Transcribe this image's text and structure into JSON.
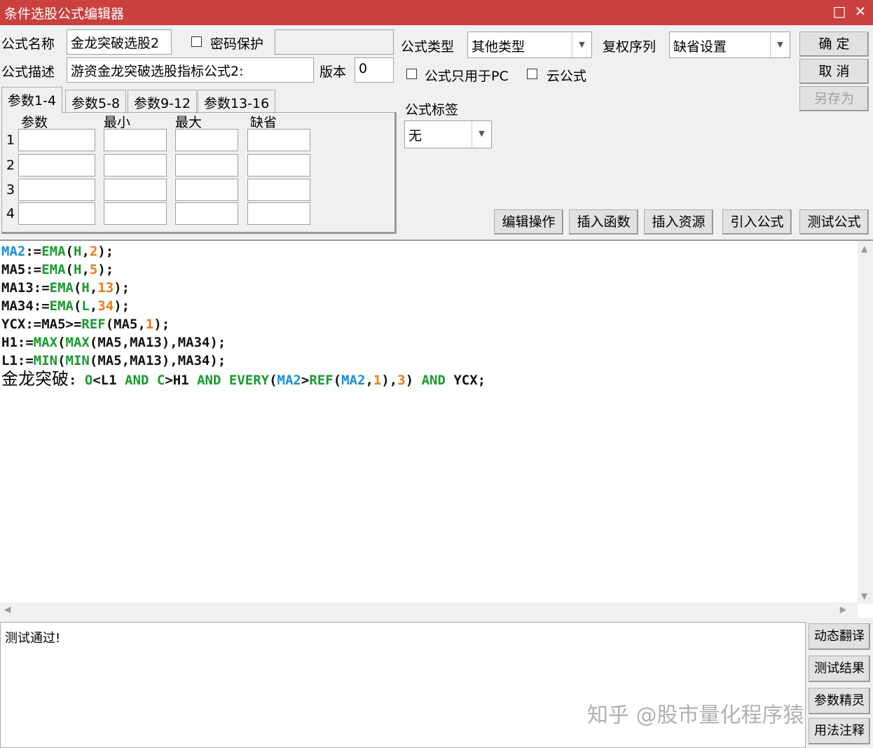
{
  "window": {
    "title": "条件选股公式编辑器",
    "maximize_icon": "□",
    "close_icon": "✕"
  },
  "form": {
    "name_label": "公式名称",
    "name_value": "金龙突破选股2",
    "password_label": "密码保护",
    "password_value": "",
    "desc_label": "公式描述",
    "desc_value": "游资金龙突破选股指标公式2:",
    "version_label": "版本",
    "version_value": "0",
    "type_label": "公式类型",
    "type_value": "其他类型",
    "rights_label": "复权序列",
    "rights_value": "缺省设置",
    "pc_only_label": "公式只用于PC",
    "cloud_label": "云公式",
    "tag_label": "公式标签",
    "tag_value": "无"
  },
  "buttons": {
    "ok": "确  定",
    "cancel": "取  消",
    "save_as": "另存为"
  },
  "params": {
    "tabs": [
      "参数1-4",
      "参数5-8",
      "参数9-12",
      "参数13-16"
    ],
    "headers": [
      "参数",
      "最小",
      "最大",
      "缺省"
    ],
    "rows": [
      "1",
      "2",
      "3",
      "4"
    ]
  },
  "toolbar": [
    "编辑操作",
    "插入函数",
    "插入资源",
    "引入公式",
    "测试公式"
  ],
  "code": [
    [
      [
        "MA2",
        "b"
      ],
      [
        ":=",
        "k"
      ],
      [
        "EMA",
        "g"
      ],
      [
        "(",
        "k"
      ],
      [
        "H",
        "g"
      ],
      [
        ",",
        "k"
      ],
      [
        "2",
        "o"
      ],
      [
        ");",
        "k"
      ]
    ],
    [
      [
        "MA5:=",
        "k"
      ],
      [
        "EMA",
        "g"
      ],
      [
        "(",
        "k"
      ],
      [
        "H",
        "g"
      ],
      [
        ",",
        "k"
      ],
      [
        "5",
        "o"
      ],
      [
        ");",
        "k"
      ]
    ],
    [
      [
        "MA13:=",
        "k"
      ],
      [
        "EMA",
        "g"
      ],
      [
        "(",
        "k"
      ],
      [
        "H",
        "g"
      ],
      [
        ",",
        "k"
      ],
      [
        "13",
        "o"
      ],
      [
        ");",
        "k"
      ]
    ],
    [
      [
        "MA34:=",
        "k"
      ],
      [
        "EMA",
        "g"
      ],
      [
        "(",
        "k"
      ],
      [
        "L",
        "g"
      ],
      [
        ",",
        "k"
      ],
      [
        "34",
        "o"
      ],
      [
        ");",
        "k"
      ]
    ],
    [
      [
        "YCX:=MA5>=",
        "k"
      ],
      [
        "REF",
        "g"
      ],
      [
        "(MA5,",
        "k"
      ],
      [
        "1",
        "o"
      ],
      [
        ");",
        "k"
      ]
    ],
    [
      [
        "H1:=",
        "k"
      ],
      [
        "MAX",
        "g"
      ],
      [
        "(",
        "k"
      ],
      [
        "MAX",
        "g"
      ],
      [
        "(MA5,MA13),MA34);",
        "k"
      ]
    ],
    [
      [
        "L1:=",
        "k"
      ],
      [
        "MIN",
        "g"
      ],
      [
        "(",
        "k"
      ],
      [
        "MIN",
        "g"
      ],
      [
        "(MA5,MA13),MA34);",
        "k"
      ]
    ],
    [
      [
        "金龙突破",
        "zh"
      ],
      [
        ": ",
        "k"
      ],
      [
        "O",
        "g"
      ],
      [
        "<L1 ",
        "k"
      ],
      [
        "AND",
        "g"
      ],
      [
        " ",
        "k"
      ],
      [
        "C",
        "g"
      ],
      [
        ">H1 ",
        "k"
      ],
      [
        "AND",
        "g"
      ],
      [
        " ",
        "k"
      ],
      [
        "EVERY",
        "g"
      ],
      [
        "(",
        "k"
      ],
      [
        "MA2",
        "b"
      ],
      [
        ">",
        "k"
      ],
      [
        "REF",
        "g"
      ],
      [
        "(",
        "k"
      ],
      [
        "MA2",
        "b"
      ],
      [
        ",",
        "k"
      ],
      [
        "1",
        "o"
      ],
      [
        "),",
        "k"
      ],
      [
        "3",
        "o"
      ],
      [
        ") ",
        "k"
      ],
      [
        "AND",
        "g"
      ],
      [
        " YCX;",
        "k"
      ]
    ]
  ],
  "output": {
    "text": "测试通过!"
  },
  "side_buttons": [
    "动态翻译",
    "测试结果",
    "参数精灵",
    "用法注释"
  ],
  "watermark": "知乎 @股市量化程序猿",
  "colors": {
    "title_bar": "#c9403f",
    "var": "#1a8fd6",
    "func": "#1a9a30",
    "number": "#f07818"
  }
}
